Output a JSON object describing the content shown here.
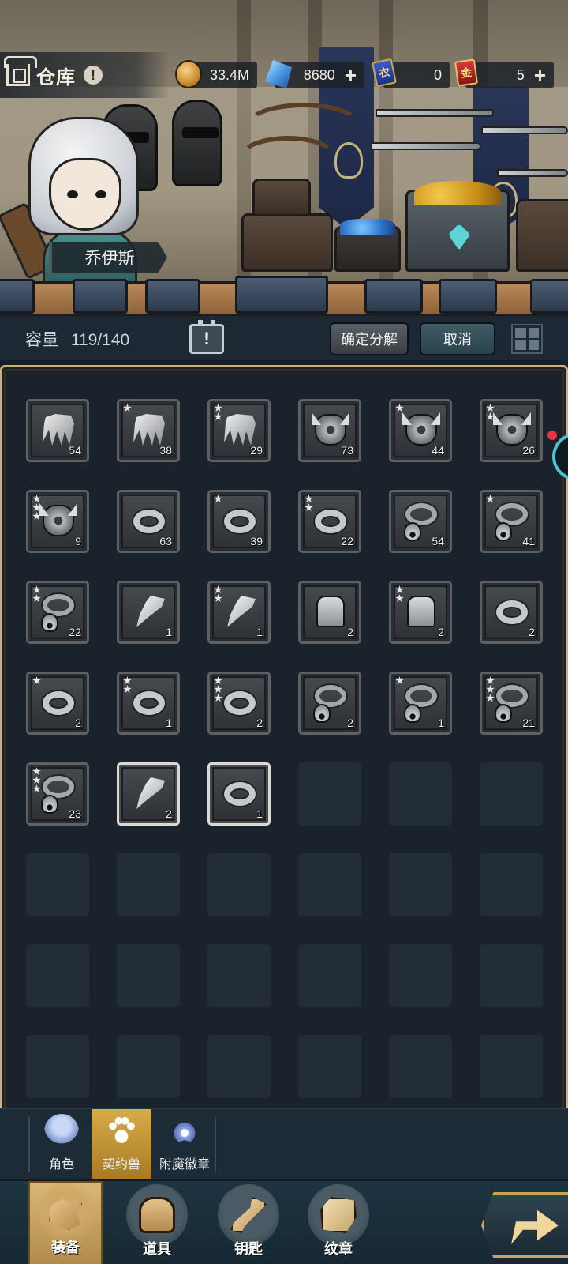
{
  "header": {
    "title": "仓库",
    "info_icon": "!",
    "character_name": "乔伊斯",
    "resources": [
      {
        "icon": "gold-coin-icon",
        "value": "33.4M",
        "plus": ""
      },
      {
        "icon": "crystal-icon",
        "value": "8680",
        "plus": "+"
      },
      {
        "icon": "blue-ticket-icon",
        "badge": "衣",
        "value": "0",
        "plus": ""
      },
      {
        "icon": "red-ticket-icon",
        "badge": "金",
        "value": "5",
        "plus": "+"
      }
    ]
  },
  "capacity": {
    "label": "容量",
    "value": "119/140",
    "sort_icon": "!"
  },
  "actions": {
    "confirm_label": "确定分解",
    "cancel_label": "取消"
  },
  "inventory": [
    {
      "type": "claw",
      "stars": 0,
      "qty": "54"
    },
    {
      "type": "claw",
      "stars": 1,
      "qty": "38"
    },
    {
      "type": "claw",
      "stars": 2,
      "qty": "29"
    },
    {
      "type": "armor",
      "stars": 0,
      "qty": "73"
    },
    {
      "type": "armor",
      "stars": 1,
      "qty": "44"
    },
    {
      "type": "armor",
      "stars": 2,
      "qty": "26"
    },
    {
      "type": "armor",
      "stars": 3,
      "qty": "9"
    },
    {
      "type": "ring",
      "stars": 0,
      "qty": "63"
    },
    {
      "type": "ring",
      "stars": 1,
      "qty": "39"
    },
    {
      "type": "ring",
      "stars": 2,
      "qty": "22"
    },
    {
      "type": "collar",
      "stars": 0,
      "qty": "54"
    },
    {
      "type": "collar",
      "stars": 1,
      "qty": "41"
    },
    {
      "type": "collar",
      "stars": 2,
      "qty": "22"
    },
    {
      "type": "fang",
      "stars": 0,
      "qty": "1"
    },
    {
      "type": "fang",
      "stars": 2,
      "qty": "1"
    },
    {
      "type": "boot",
      "stars": 0,
      "qty": "2"
    },
    {
      "type": "boot",
      "stars": 2,
      "qty": "2"
    },
    {
      "type": "ring",
      "stars": 0,
      "qty": "2"
    },
    {
      "type": "ring",
      "stars": 1,
      "qty": "2"
    },
    {
      "type": "ring",
      "stars": 2,
      "qty": "1"
    },
    {
      "type": "ring",
      "stars": 3,
      "qty": "2"
    },
    {
      "type": "collar",
      "stars": 0,
      "qty": "2"
    },
    {
      "type": "collar",
      "stars": 1,
      "qty": "1"
    },
    {
      "type": "collar",
      "stars": 3,
      "qty": "21"
    },
    {
      "type": "collar",
      "stars": 3,
      "qty": "23"
    },
    {
      "type": "fang",
      "stars": 0,
      "qty": "2",
      "tier": "white"
    },
    {
      "type": "ring",
      "stars": 0,
      "qty": "1",
      "tier": "white"
    }
  ],
  "empty_slots": 21,
  "categories": [
    {
      "label": "角色",
      "icon": "person-icon",
      "active": false
    },
    {
      "label": "契约兽",
      "icon": "paw-icon",
      "active": true
    },
    {
      "label": "附魔徽章",
      "icon": "badge-icon",
      "active": false
    }
  ],
  "nav": [
    {
      "label": "装备",
      "icon": "equipment-icon",
      "active": true
    },
    {
      "label": "道具",
      "icon": "items-icon",
      "active": false
    },
    {
      "label": "钥匙",
      "icon": "key-icon",
      "active": false
    },
    {
      "label": "纹章",
      "icon": "emblem-icon",
      "active": false
    }
  ]
}
